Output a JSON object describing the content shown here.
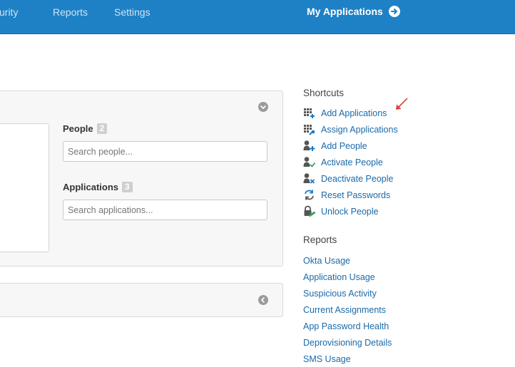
{
  "nav": {
    "security": "curity",
    "reports": "Reports",
    "settings": "Settings",
    "my_applications": "My Applications"
  },
  "main_panel": {
    "people_label": "People",
    "people_count": "2",
    "people_placeholder": "Search people...",
    "applications_label": "Applications",
    "applications_count": "3",
    "applications_placeholder": "Search applications..."
  },
  "shortcuts": {
    "heading": "Shortcuts",
    "items": [
      {
        "label": "Add Applications",
        "icon": "grid-add-icon"
      },
      {
        "label": "Assign Applications",
        "icon": "grid-assign-icon"
      },
      {
        "label": "Add People",
        "icon": "person-add-icon"
      },
      {
        "label": "Activate People",
        "icon": "person-check-icon"
      },
      {
        "label": "Deactivate People",
        "icon": "person-x-icon"
      },
      {
        "label": "Reset Passwords",
        "icon": "refresh-icon"
      },
      {
        "label": "Unlock People",
        "icon": "lock-icon"
      }
    ]
  },
  "reports": {
    "heading": "Reports",
    "items": [
      "Okta Usage",
      "Application Usage",
      "Suspicious Activity",
      "Current Assignments",
      "App Password Health",
      "Deprovisioning Details",
      "SMS Usage"
    ]
  },
  "colors": {
    "topbar": "#1e81c6",
    "link": "#1a6aa9",
    "accent_green": "#3aa35b",
    "accent_blue": "#1a7ac4",
    "annotation_red": "#e0403a"
  }
}
